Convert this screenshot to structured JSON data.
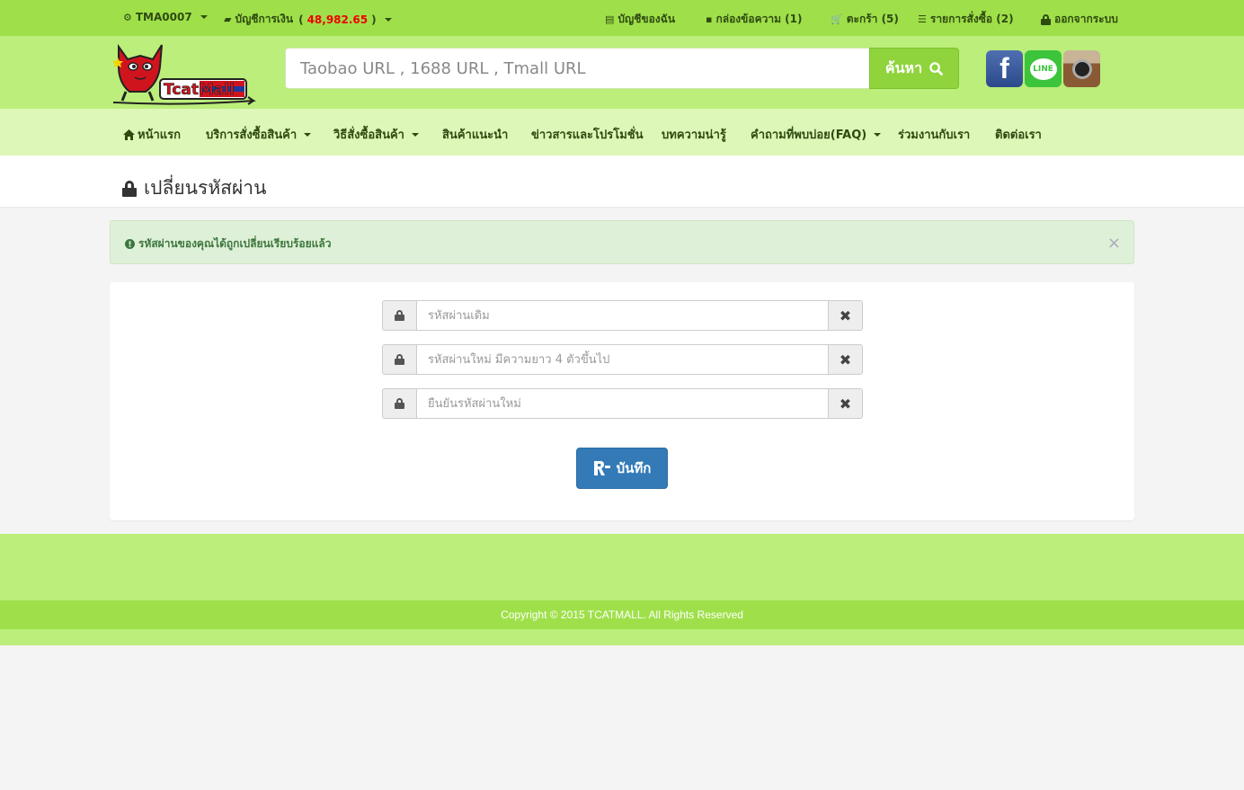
{
  "topbar": {
    "user_id": "TMA0007",
    "wallet_label": "บัญชีการเงิน",
    "wallet_open": "(",
    "wallet_amount": "48,982.65",
    "wallet_close": ")",
    "my_account": "บัญชีของฉัน",
    "messages": "กล่องข้อความ (1)",
    "cart": "ตะกร้า (5)",
    "orders": "รายการสั่งซื้อ (2)",
    "logout": "ออกจากระบบ"
  },
  "header": {
    "search_placeholder": "Taobao URL , 1688 URL , Tmall URL",
    "search_button": "ค้นหา",
    "logo_text": "TcatMall"
  },
  "nav": {
    "items": [
      {
        "label": "หน้าแรก"
      },
      {
        "label": "บริการสั่งซื้อสินค้า"
      },
      {
        "label": "วิธีสั่งซื้อสินค้า"
      },
      {
        "label": "สินค้าแนะนำ"
      },
      {
        "label": "ข่าวสารและโปรโมชั่น"
      },
      {
        "label": "บทความน่ารู้"
      },
      {
        "label": "คำถามที่พบบ่อย(FAQ)"
      },
      {
        "label": "ร่วมงานกับเรา"
      },
      {
        "label": "ติดต่อเรา"
      }
    ]
  },
  "page": {
    "title": "เปลี่ยนรหัสผ่าน"
  },
  "alert": {
    "message": "รหัสผ่านของคุณได้ถูกเปลี่ยนเรียบร้อยแล้ว"
  },
  "form": {
    "old_password_placeholder": "รหัสผ่านเดิม",
    "new_password_placeholder": "รหัสผ่านใหม่ มีความยาว 4 ตัวขึ้นไป",
    "confirm_password_placeholder": "ยืนยันรหัสผ่านใหม่",
    "save_label": "บันทึก"
  },
  "footer": {
    "copyright": "Copyright © 2015 TCATMALL. All Rights Reserved"
  },
  "colors": {
    "topbar": "#9fe04a",
    "header": "#bbee7a",
    "nav": "#ddf7b8",
    "primary_button": "#337ab7",
    "alert_bg": "#dff0d8"
  },
  "icons": {
    "user": "gear-icon",
    "wallet": "wallet-icon",
    "account": "list-alt-icon",
    "messages": "comment-icon",
    "cart": "cart-icon",
    "orders": "list-icon",
    "logout": "lock-icon",
    "home": "home-icon",
    "search": "search-icon",
    "clear": "close-icon",
    "save": "save-icon",
    "alert": "exclamation-circle-icon"
  }
}
